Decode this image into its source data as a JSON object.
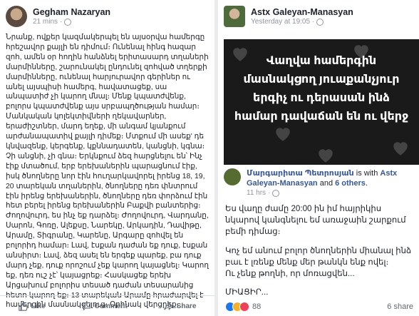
{
  "left_post": {
    "author": "Gegham Nazaryan",
    "time": "21 mins",
    "dot": "·",
    "body": "Նրանք, ովքեր կազմակերպել են այսօրվա համերգը հրեշավոր քայլի են դիմում։ Ունենալ հինգ հազար զոհ, ամեն օր հողին հանձնել երիտասարդ տղաների մարմինները, շարունակել ընդունել զոհված տղերքի մարմինները, ունենալ հարյուրավոր գերիներ ու անել այսպիսի համերգ, հավատացեք, սա անպատիժ չի կարող մնալ։ Մենք կպատժվենք, բոլորս կպատժվենք այս սրբապղծության համար։ Մանկական կոլեկտիվների ղեկավարներ, երաժիշտներ, մարդ եղեք, մի անգամ կյանքում արժանապատիվ քայլի դիմեք։ Մտքում մի ասեք' դե կնվազենք, կերգենք, կքննադատեն, կանցնի, կգնա։ Չի անցնի, չի գնա։ Երկնքում ձեզ հարցնելու են՝ Ինչ էիք մտածում, երբ երեխաներին պարացնում էիք, իսկ ծնողները նոր էին հուղարկավորել իրենց 18, 19, 20 տարեկան տղաներին, ծնողները դեռ փնտրում էին իրենց երեխաներին, ծնողները դեռ փորձում էին հետ բերել իրենց երեխաներին Բաքվի բանտերից։ Ժողովուրդ, ես ինչ եք դարձել։ Ժողովուրդ, Վարդանը, Սարոն, Գոռը, Ալեքսը, Նարեկը, Արկադին, Դավիթը, Արամը, Տիգրանը, Կարենը, Արգարը զոհվել են բոլորիդ համար։ Լավ, էսքան դաժան եք դուք, էսքան անսիրտ։ Լավ, ձեզ ասել են երգեք պարեք, բա դուք մարդ չեք, դուք որոշում չեք կարող կայացնել։ Կարող եք, դեռ ուշ չէ՝ կայացրեք։ Հասկացեք երեխ Արցախում բոլորիս տեսած դաժան տեսարանից հետո կարող եք։ 13 տարեկան Արամը հրաժարվել է համերգին մասնակցելուց։ Օրինակ վերցրեք։",
    "like_label": "Like",
    "comment_label": "Comment",
    "share_label": "Share"
  },
  "right_post": {
    "author": "Astx Galeyan-Manasyan",
    "time": "Yesterday at 19:05",
    "dot": "·",
    "banner_text": "Վաղվա համերգին մասնակցող յուաքանչյուր երգիչ ու դերասան ինձ համար դավաճան են ու վերջ",
    "shared_author": "Մարգարիտա Պետրոսյան",
    "shared_with": " is with ",
    "shared_tag": "Astx Galeyan-Manasyan",
    "shared_and": " and ",
    "shared_others": "6 others",
    "shared_dot": ".",
    "shared_time": "11 hrs",
    "body_line1": "Ես վաղը ժամը 20:00 ին իմ հայրիկիս նկարով կանգնելու եմ առաջաին շարքում բեմի դիմաց։",
    "body_line2": "Կոչ եմ անում բոլոր ծնողներին միանալ ինձ բաւ է լռենք մենք մեր թանկն ենք ովել։",
    "body_line3": "Ու չենք թողնի, որ մոռացվեն...",
    "body_line4": "ՄԻԱՑԻՐ...",
    "reaction_count": "88",
    "share_count": "6 share"
  },
  "colors": {
    "accent": "#365899",
    "text": "#1d2129",
    "muted": "#90949c",
    "banner_bg": "#1a1a1a"
  }
}
